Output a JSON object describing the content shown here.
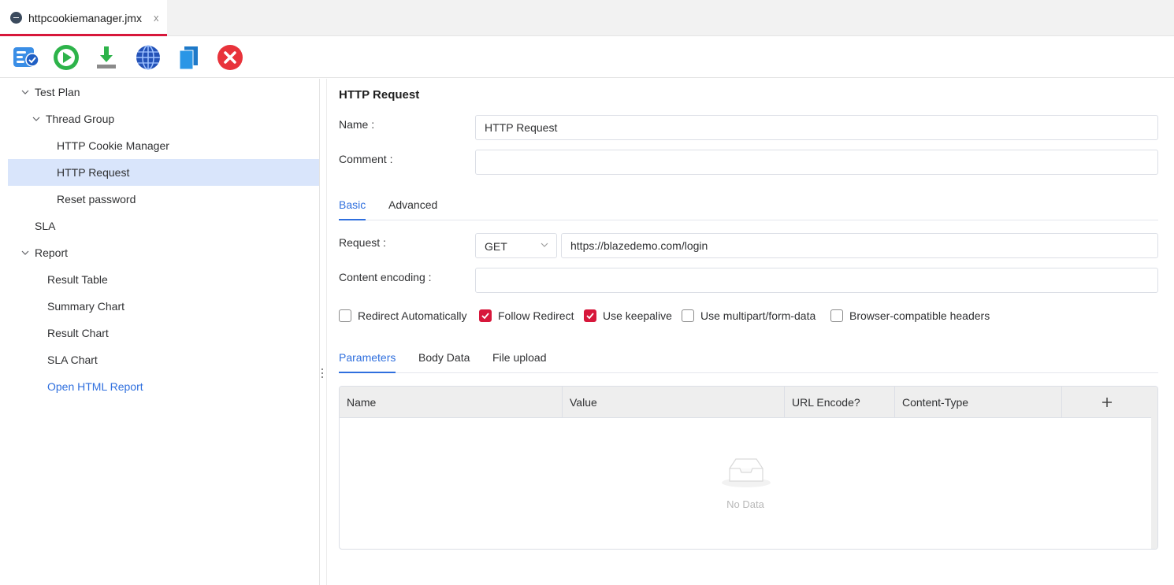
{
  "tab": {
    "title": "httpcookiemanager.jmx",
    "close": "x"
  },
  "toolbar": {
    "buttons": [
      {
        "name": "validate-plan-icon"
      },
      {
        "name": "run-icon"
      },
      {
        "name": "download-icon"
      },
      {
        "name": "globe-icon"
      },
      {
        "name": "copy-icon"
      },
      {
        "name": "stop-icon"
      }
    ]
  },
  "tree": {
    "items": [
      {
        "label": "Test Plan",
        "expanded": true,
        "level": 0
      },
      {
        "label": "Thread Group",
        "expanded": true,
        "level": 1
      },
      {
        "label": "HTTP Cookie Manager",
        "level": 2
      },
      {
        "label": "HTTP Request",
        "level": 2,
        "selected": true
      },
      {
        "label": "Reset password",
        "level": 2
      },
      {
        "label": "SLA",
        "level": 0
      },
      {
        "label": "Report",
        "expanded": true,
        "level": 0
      },
      {
        "label": "Result Table",
        "level": 1
      },
      {
        "label": "Summary Chart",
        "level": 1
      },
      {
        "label": "Result Chart",
        "level": 1
      },
      {
        "label": "SLA Chart",
        "level": 1
      },
      {
        "label": "Open HTML Report",
        "level": 1,
        "link": true
      }
    ]
  },
  "panel": {
    "title": "HTTP Request",
    "name_label": "Name :",
    "name_value": "HTTP Request",
    "comment_label": "Comment :",
    "comment_value": "",
    "tabs": [
      "Basic",
      "Advanced"
    ],
    "active_tab": "Basic",
    "request_label": "Request :",
    "method": "GET",
    "url": "https://blazedemo.com/login",
    "encoding_label": "Content encoding :",
    "encoding_value": "",
    "checkboxes": [
      {
        "label": "Redirect Automatically",
        "checked": false
      },
      {
        "label": "Follow Redirect",
        "checked": true
      },
      {
        "label": "Use keepalive",
        "checked": true
      },
      {
        "label": "Use multipart/form-data",
        "checked": false
      },
      {
        "label": "Browser-compatible headers",
        "checked": false
      }
    ],
    "sub_tabs": [
      "Parameters",
      "Body Data",
      "File upload"
    ],
    "active_sub_tab": "Parameters",
    "table": {
      "columns": [
        "Name",
        "Value",
        "URL Encode?",
        "Content-Type"
      ],
      "add": "+",
      "empty_text": "No Data"
    }
  },
  "colors": {
    "accent": "#2f6fde",
    "brand_red": "#d7173b",
    "selected_row": "#d9e5fb"
  }
}
